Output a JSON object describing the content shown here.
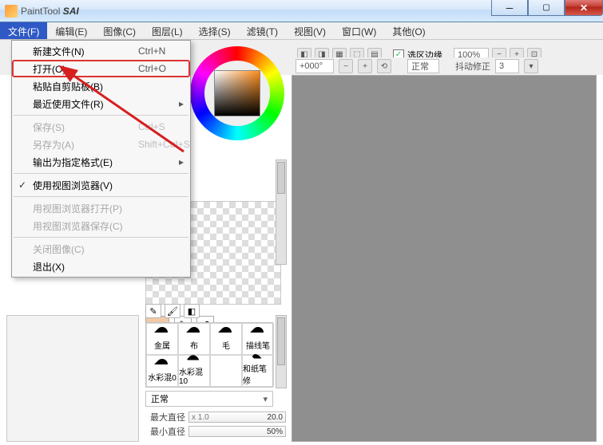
{
  "title": {
    "app_prefix": "PaintTool",
    "app_name": "SAI"
  },
  "window_buttons": {
    "min": "min",
    "max": "max",
    "close": "close"
  },
  "menubar": [
    {
      "label": "文件(F)",
      "active": true
    },
    {
      "label": "编辑(E)"
    },
    {
      "label": "图像(C)"
    },
    {
      "label": "图层(L)"
    },
    {
      "label": "选择(S)"
    },
    {
      "label": "滤镜(T)"
    },
    {
      "label": "视图(V)"
    },
    {
      "label": "窗口(W)"
    },
    {
      "label": "其他(O)"
    }
  ],
  "file_menu": [
    {
      "label": "新建文件(N)",
      "shortcut": "Ctrl+N",
      "enabled": true
    },
    {
      "label": "打开(O)",
      "shortcut": "Ctrl+O",
      "enabled": true,
      "highlight": true
    },
    {
      "label": "粘贴自剪贴板(B)",
      "enabled": true
    },
    {
      "label": "最近使用文件(R)",
      "enabled": true,
      "submenu": true
    },
    {
      "sep": true
    },
    {
      "label": "保存(S)",
      "shortcut": "Ctrl+S",
      "enabled": false
    },
    {
      "label": "另存为(A)",
      "shortcut": "Shift+Ctrl+S",
      "enabled": false
    },
    {
      "label": "输出为指定格式(E)",
      "enabled": true,
      "submenu": true
    },
    {
      "sep": true
    },
    {
      "label": "使用视图浏览器(V)",
      "enabled": true,
      "checked": true
    },
    {
      "sep": true
    },
    {
      "label": "用视图浏览器打开(P)",
      "enabled": false
    },
    {
      "label": "用视图浏览器保存(C)",
      "enabled": false
    },
    {
      "sep": true
    },
    {
      "label": "关闭图像(C)",
      "enabled": false
    },
    {
      "label": "退出(X)",
      "enabled": true
    }
  ],
  "toolbar": {
    "sel_edge_label": "选区边缘",
    "sel_edge_checked": true,
    "zoom": "100%",
    "angle": "+000°",
    "blend": "正常",
    "stabilizer_label": "抖动修正",
    "stabilizer_value": "3"
  },
  "brushes": [
    {
      "name": "金属"
    },
    {
      "name": "布"
    },
    {
      "name": "毛"
    },
    {
      "name": "描线笔"
    },
    {
      "name": "水彩混0"
    },
    {
      "name": "水彩混10"
    },
    {
      "name": ""
    },
    {
      "name": "和纸笔修"
    }
  ],
  "brush_mode": "正常",
  "sliders": {
    "max_diam_label": "最大直径",
    "max_diam_left": "x 1.0",
    "max_diam_right": "20.0",
    "min_diam_label": "最小直径",
    "min_diam_right": "50%"
  },
  "swatch_color": "#f2c9a6"
}
